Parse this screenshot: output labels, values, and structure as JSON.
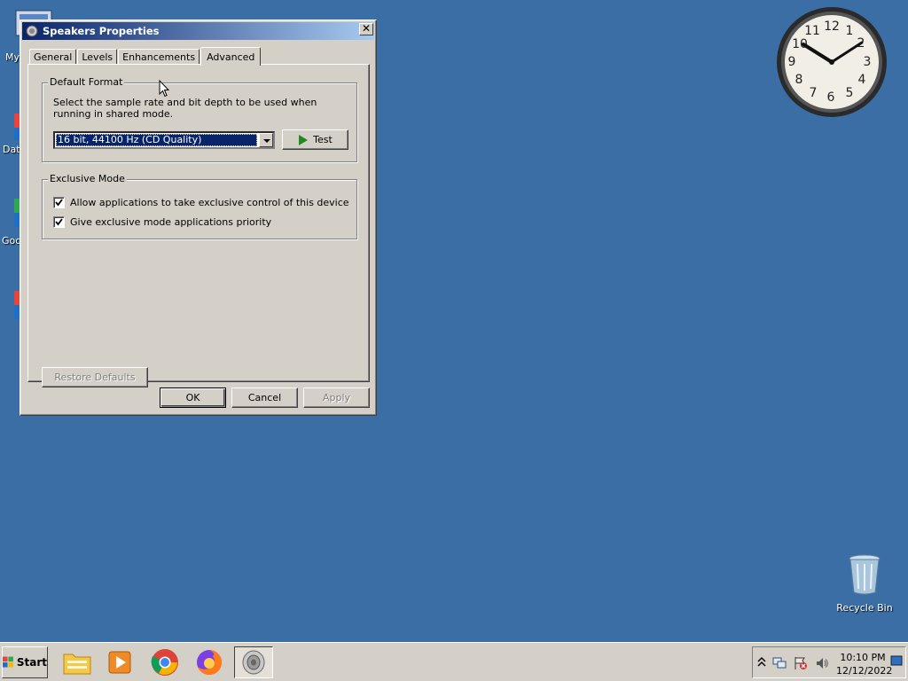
{
  "desktop": {
    "icons": [
      {
        "label": "My"
      },
      {
        "label": "Dat"
      },
      {
        "label": "Goo"
      }
    ],
    "recycle_bin": {
      "label": "Recycle Bin"
    },
    "clock": {
      "numbers": [
        "12",
        "1",
        "2",
        "3",
        "4",
        "5",
        "6",
        "7",
        "8",
        "9",
        "10",
        "11"
      ]
    }
  },
  "window": {
    "title": "Speakers Properties",
    "close_glyph": "✕",
    "tabs": [
      {
        "label": "General",
        "active": false
      },
      {
        "label": "Levels",
        "active": false
      },
      {
        "label": "Enhancements",
        "active": false
      },
      {
        "label": "Advanced",
        "active": true
      }
    ],
    "default_format": {
      "legend": "Default Format",
      "description": "Select the sample rate and bit depth to be used when running in shared mode.",
      "selected": "16 bit, 44100 Hz (CD Quality)",
      "test_label": "Test"
    },
    "exclusive_mode": {
      "legend": "Exclusive Mode",
      "options": [
        {
          "label": "Allow applications to take exclusive control of this device",
          "checked": true
        },
        {
          "label": "Give exclusive mode applications priority",
          "checked": true
        }
      ]
    },
    "restore_label": "Restore Defaults",
    "ok_label": "OK",
    "cancel_label": "Cancel",
    "apply_label": "Apply"
  },
  "taskbar": {
    "start_label": "Start",
    "apps": [
      {
        "icon": "file-explorer-icon"
      },
      {
        "icon": "media-player-icon"
      },
      {
        "icon": "chrome-icon"
      },
      {
        "icon": "firefox-icon"
      },
      {
        "icon": "speaker-icon",
        "active": true
      }
    ],
    "tray": {
      "time": "10:10 PM",
      "date": "12/12/2022"
    }
  },
  "colors": {
    "desktop": "#3a6ea5",
    "titlebar_start": "#0a246a",
    "titlebar_end": "#a6caf0",
    "face": "#d4d0c8"
  }
}
